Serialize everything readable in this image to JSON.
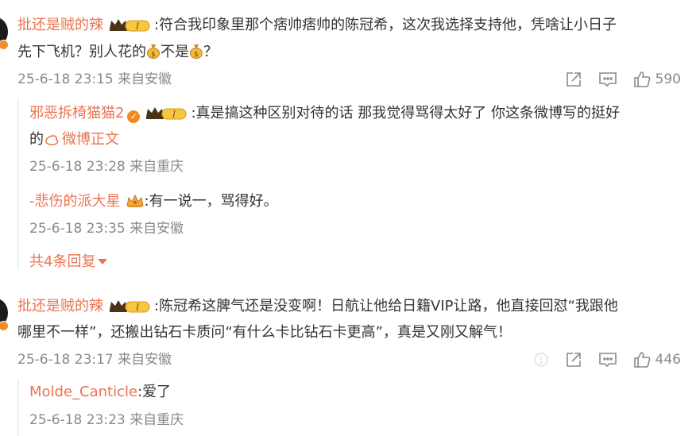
{
  "comments": [
    {
      "username": "批还是贼的辣",
      "level_badge": "I",
      "text_line1": ":符合我印象里那个痞帅痞帅的陈冠希，这次我选择支持他，凭啥让小日子",
      "text_line2_a": "先下飞机？别人花的",
      "text_line2_b": "不是",
      "text_line2_c": "？",
      "timestamp": "25-6-18 23:15 来自安徽",
      "likes": "590",
      "replies": [
        {
          "username": "邪恶拆椅猫猫2",
          "level_badge": "I",
          "text_line1": ":真是搞这种区别对待的话 那我觉得骂得太好了 你这条微博写的挺好",
          "text_line2_a": "的",
          "link_text": "微博正文",
          "timestamp": "25-6-18 23:28 来自重庆"
        },
        {
          "username": "-悲伤的派大星",
          "text_line1": ":有一说一，骂得好。",
          "timestamp": "25-6-18 23:35 来自安徽"
        }
      ],
      "more_replies": "共4条回复"
    },
    {
      "username": "批还是贼的辣",
      "level_badge": "I",
      "text_line1": ":陈冠希这脾气还是没变啊！日航让他给日籍VIP让路，他直接回怼“我跟他",
      "text_line2": "哪里不一样”，还搬出钻石卡质问“有什么卡比钻石卡更高”，真是又刚又解气！",
      "timestamp": "25-6-18 23:17 来自安徽",
      "likes": "446",
      "replies": [
        {
          "username": "Molde_Canticle",
          "text_line1": ":爱了",
          "timestamp": "25-6-18 23:23 来自重庆"
        }
      ]
    }
  ],
  "colors": {
    "username": "#eb7350",
    "text": "#333333",
    "meta": "#8a8a8a",
    "badge": "#f08a24"
  },
  "icons": [
    "share-icon",
    "comment-icon",
    "like-icon",
    "money-bag-emoji",
    "crown-emoji",
    "verified-badge-icon",
    "weibo-logo-icon",
    "dropdown-caret-icon",
    "info-icon"
  ]
}
